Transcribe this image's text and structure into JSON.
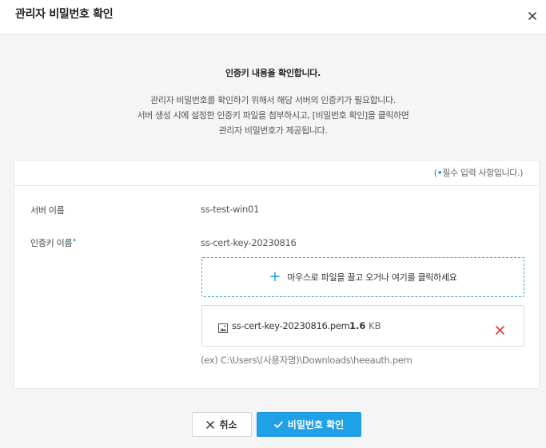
{
  "dialog": {
    "title": "관리자 비밀번호 확인",
    "close_icon": "close-icon"
  },
  "intro": {
    "heading": "인증키 내용을 확인합니다.",
    "line1": "관리자 비밀번호를 확인하기 위해서 해당 서버의 인증키가 필요합니다.",
    "line2": "서버 생성 시에 설정한 인증키 파일을 첨부하시고, [비밀번호 확인]을 클릭하면",
    "line3": "관리자 비밀번호가 제공됩니다."
  },
  "form": {
    "required_note_prefix": "(",
    "required_note_dot": "•",
    "required_note_text": "필수 입력 사항입니다.)",
    "server_name_label": "서버 이름",
    "server_name_value": "ss-test-win01",
    "cert_key_label": "인증키 이름",
    "required_dot": "•",
    "cert_key_value": "ss-cert-key-20230816",
    "dropzone_text": "마우스로 파일을 끌고 오거나 여기를 클릭하세요",
    "file": {
      "name": "ss-cert-key-20230816.pem",
      "size_value": "1.6",
      "size_unit": "KB",
      "icon": "image-file-icon"
    },
    "path_hint": "(ex) C:\\Users\\(사용자명)\\Downloads\\heeauth.pem"
  },
  "buttons": {
    "cancel_label": "취소",
    "confirm_label": "비밀번호 확인"
  },
  "colors": {
    "accent": "#1ea1e6",
    "remove_red": "#e53935",
    "background": "#f5f5f5"
  }
}
